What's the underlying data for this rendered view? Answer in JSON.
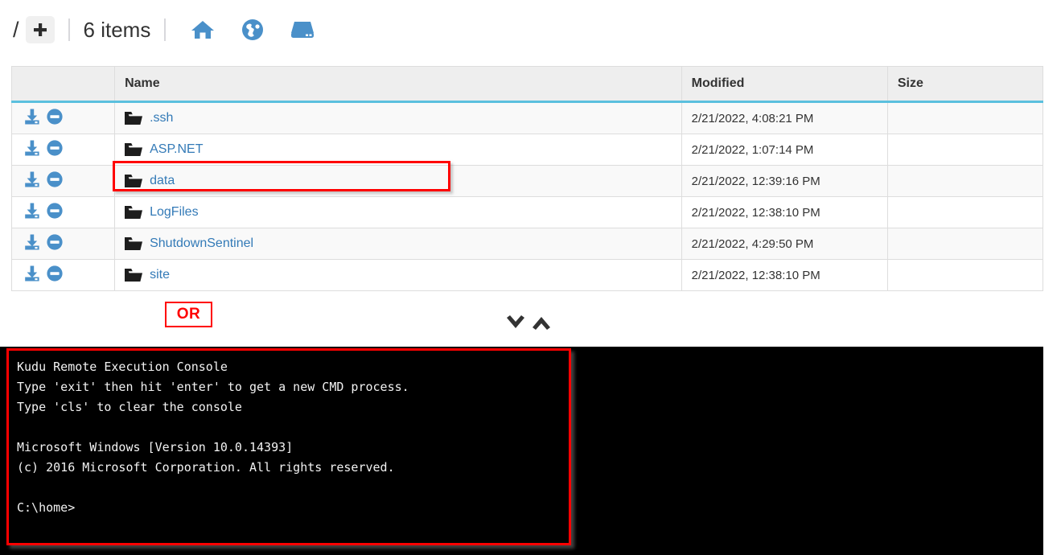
{
  "toolbar": {
    "breadcrumb_root": "/",
    "add_button_label": "+",
    "add_button_icon": "plus-icon",
    "items_count_label": "6 items",
    "icons": [
      {
        "name": "home-icon",
        "title": "Home"
      },
      {
        "name": "globe-icon",
        "title": "Site"
      },
      {
        "name": "server-drive-icon",
        "title": "Server"
      }
    ]
  },
  "table": {
    "columns": [
      "",
      "Name",
      "Modified",
      "Size"
    ],
    "row_actions": [
      {
        "name": "download-icon",
        "title": "Download"
      },
      {
        "name": "delete-icon",
        "title": "Delete"
      }
    ],
    "rows": [
      {
        "name": ".ssh",
        "modified": "2/21/2022, 4:08:21 PM",
        "size": "",
        "icon": "folder-icon"
      },
      {
        "name": "ASP.NET",
        "modified": "2/21/2022, 1:07:14 PM",
        "size": "",
        "icon": "folder-icon"
      },
      {
        "name": "data",
        "modified": "2/21/2022, 12:39:16 PM",
        "size": "",
        "icon": "folder-icon"
      },
      {
        "name": "LogFiles",
        "modified": "2/21/2022, 12:38:10 PM",
        "size": "",
        "icon": "folder-icon"
      },
      {
        "name": "ShutdownSentinel",
        "modified": "2/21/2022, 4:29:50 PM",
        "size": "",
        "icon": "folder-icon"
      },
      {
        "name": "site",
        "modified": "2/21/2022, 12:38:10 PM",
        "size": "",
        "icon": "folder-icon"
      }
    ]
  },
  "annotations": {
    "or_badge_label": "OR",
    "highlight_color": "#ff0000"
  },
  "chevrons": [
    {
      "name": "chevron-down-icon"
    },
    {
      "name": "chevron-up-icon"
    }
  ],
  "console": {
    "lines": [
      "Kudu Remote Execution Console",
      "Type 'exit' then hit 'enter' to get a new CMD process.",
      "Type 'cls' to clear the console",
      "",
      "Microsoft Windows [Version 10.0.14393]",
      "(c) 2016 Microsoft Corporation. All rights reserved.",
      "",
      "C:\\home>"
    ]
  },
  "colors": {
    "link_blue": "#337ab7",
    "icon_blue": "#4a90c9",
    "header_accent": "#5bc0de",
    "annotation_red": "#ff0000",
    "console_bg": "#000000"
  }
}
